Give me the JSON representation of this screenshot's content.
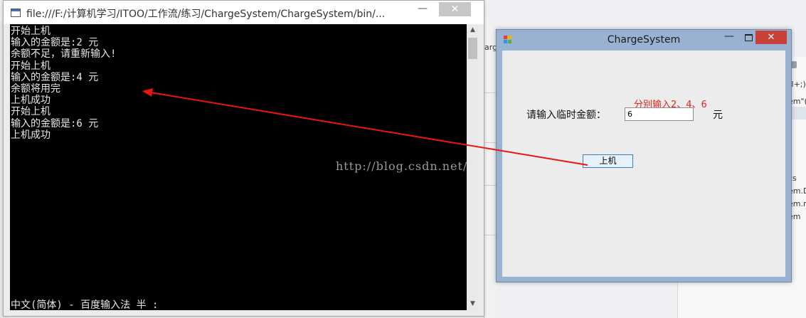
{
  "console": {
    "title": "file:///F:/计算机学习/ITOO/工作流/练习/ChargeSystem/ChargeSystem/bin/...",
    "minimize_glyph": "—",
    "close_glyph": "✕",
    "lines": [
      "开始上机",
      "输入的金额是:2 元",
      "余额不足，请重新输入!",
      "开始上机",
      "输入的金额是:4 元",
      "余额将用完",
      "上机成功",
      "开始上机",
      "输入的金额是:6 元",
      "上机成功"
    ],
    "ime_status": "中文(简体) - 百度输入法 半 :"
  },
  "form": {
    "title": "ChargeSystem",
    "minimize_glyph": "—",
    "close_glyph": "✕",
    "amount_label": "请输入临时金额：",
    "amount_value": "6",
    "unit_label": "元",
    "annotation": "分别输入2、4、6",
    "submit_label": "上机"
  },
  "watermark": "http://blog.csdn.net/",
  "background": {
    "tab_text": "arg",
    "code_lines": [
      "rl+;)",
      "em\"(",
      "cs",
      "em.D",
      "em.n",
      "em"
    ]
  },
  "colors": {
    "annotation_red": "#e0241b",
    "arrow_red": "#e8160f",
    "console_bg": "#000000",
    "form_border": "#9ab2d2",
    "close_red": "#c8423a"
  }
}
